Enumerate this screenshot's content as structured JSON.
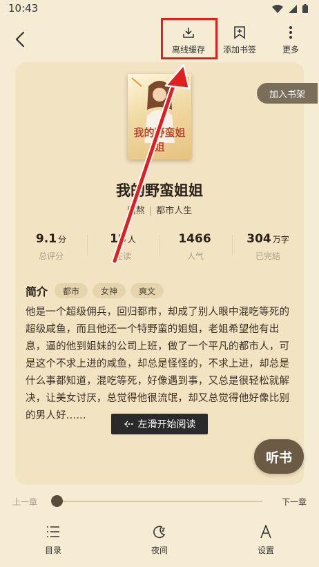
{
  "status": {
    "time": "10:43"
  },
  "toolbar": {
    "offline": "离线缓存",
    "bookmark": "添加书签",
    "more": "更多"
  },
  "book": {
    "shelf_button": "加入书架",
    "title": "我的野蛮姐姐",
    "author": "扇熬",
    "category": "都市人生",
    "cover_title": "我的野蛮姐姐"
  },
  "stats": [
    {
      "value": "9.1",
      "unit": "分",
      "label": "总评分"
    },
    {
      "value": "18",
      "unit": "人",
      "label": "在读"
    },
    {
      "value": "1466",
      "unit": "",
      "label": "人气"
    },
    {
      "value": "304",
      "unit": "万字",
      "label": "已完结"
    }
  ],
  "intro": {
    "heading": "简介",
    "tags": [
      "都市",
      "女神",
      "爽文"
    ],
    "text": "他是一个超级佣兵，回归都市，却成了别人眼中混吃等死的超级咸鱼，而且他还一个特野蛮的姐姐，老姐希望他有出息，逼的他到姐妹的公司上班，做了一个平凡的都市人，可是这个不求上进的咸鱼，却总是怪怪的，不求上进，却总是什么事都知道，混吃等死，好像遇到事，又总是很轻松就解决，让美女讨厌，总觉得他很流氓，却又总觉得他好像比别的男人好......"
  },
  "reader": {
    "swipe_hint": "左滑开始阅读",
    "listen": "听书",
    "prev_chapter": "上一章",
    "next_chapter": "下一章",
    "progress": 0
  },
  "bottom_nav": {
    "toc": "目录",
    "night": "夜间",
    "settings": "设置"
  },
  "colors": {
    "background": "#f6ebd3",
    "card": "#f2e3c2",
    "highlight": "#e01f1f"
  }
}
